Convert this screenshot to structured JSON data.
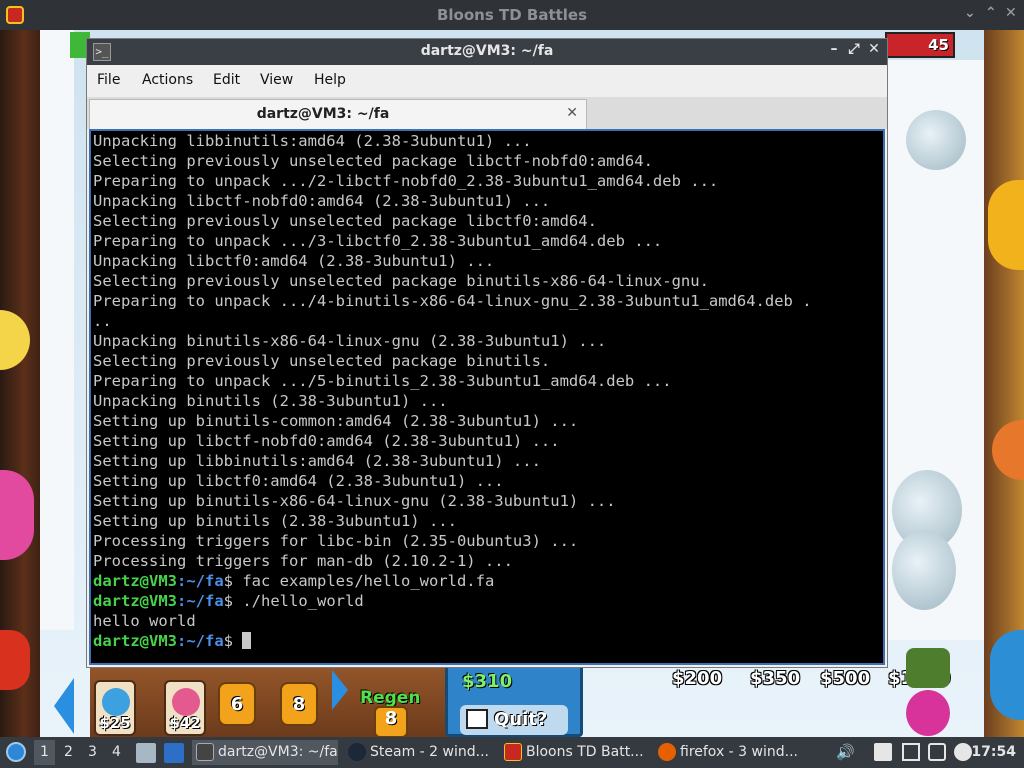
{
  "game_window": {
    "title": "Bloons TD Battles",
    "health_right": "45"
  },
  "shop": {
    "tower_prices": [
      "$25",
      "$42"
    ],
    "lock_levels": [
      "6",
      "8"
    ],
    "regen_label": "Regen",
    "regen_level": "8",
    "cash": "$310",
    "quit_label": "Quit?",
    "buy_prices": [
      "$200",
      "$350",
      "$500",
      "$1200"
    ]
  },
  "terminal": {
    "window_title": "dartz@VM3: ~/fa",
    "menu": [
      "File",
      "Actions",
      "Edit",
      "View",
      "Help"
    ],
    "tab_title": "dartz@VM3: ~/fa",
    "prompt_user": "dartz@VM3",
    "prompt_path": ":~/fa",
    "prompt_symbol": "$ ",
    "output_lines": [
      "Unpacking libbinutils:amd64 (2.38-3ubuntu1) ...",
      "Selecting previously unselected package libctf-nobfd0:amd64.",
      "Preparing to unpack .../2-libctf-nobfd0_2.38-3ubuntu1_amd64.deb ...",
      "Unpacking libctf-nobfd0:amd64 (2.38-3ubuntu1) ...",
      "Selecting previously unselected package libctf0:amd64.",
      "Preparing to unpack .../3-libctf0_2.38-3ubuntu1_amd64.deb ...",
      "Unpacking libctf0:amd64 (2.38-3ubuntu1) ...",
      "Selecting previously unselected package binutils-x86-64-linux-gnu.",
      "Preparing to unpack .../4-binutils-x86-64-linux-gnu_2.38-3ubuntu1_amd64.deb .",
      "..",
      "Unpacking binutils-x86-64-linux-gnu (2.38-3ubuntu1) ...",
      "Selecting previously unselected package binutils.",
      "Preparing to unpack .../5-binutils_2.38-3ubuntu1_amd64.deb ...",
      "Unpacking binutils (2.38-3ubuntu1) ...",
      "Setting up binutils-common:amd64 (2.38-3ubuntu1) ...",
      "Setting up libctf-nobfd0:amd64 (2.38-3ubuntu1) ...",
      "Setting up libbinutils:amd64 (2.38-3ubuntu1) ...",
      "Setting up libctf0:amd64 (2.38-3ubuntu1) ...",
      "Setting up binutils-x86-64-linux-gnu (2.38-3ubuntu1) ...",
      "Setting up binutils (2.38-3ubuntu1) ...",
      "Processing triggers for libc-bin (2.35-0ubuntu3) ...",
      "Processing triggers for man-db (2.10.2-1) ..."
    ],
    "command_1": "fac examples/hello_world.fa",
    "command_2": "./hello_world",
    "program_output": "hello world"
  },
  "taskbar": {
    "workspaces": [
      "1",
      "2",
      "3",
      "4"
    ],
    "tasks": [
      "dartz@VM3: ~/fa",
      "Steam - 2 wind...",
      "Bloons TD Batt...",
      "firefox - 3 wind..."
    ],
    "clock": "17:54"
  },
  "colors": {
    "prompt_user": "#46d24a",
    "prompt_path": "#4c8fe8",
    "terminal_bg": "#000000",
    "terminal_border": "#3d6fb4"
  }
}
